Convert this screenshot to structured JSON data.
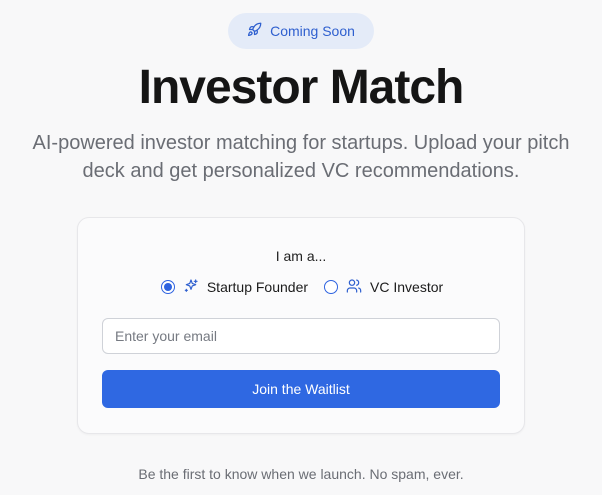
{
  "badge": {
    "label": "Coming Soon",
    "icon": "rocket-icon"
  },
  "hero": {
    "title": "Investor Match",
    "subtitle": "AI-powered investor matching for startups. Upload your pitch deck and get personalized VC recommendations."
  },
  "form": {
    "prompt": "I am a...",
    "roles": [
      {
        "label": "Startup Founder",
        "icon": "sparkles-icon",
        "selected": true
      },
      {
        "label": "VC Investor",
        "icon": "users-icon",
        "selected": false
      }
    ],
    "email_placeholder": "Enter your email",
    "email_value": "",
    "submit_label": "Join the Waitlist"
  },
  "footer": {
    "text": "Be the first to know when we launch. No spam, ever."
  },
  "colors": {
    "accent": "#2f68e2",
    "badge_bg": "#e4ebf8",
    "background": "#f8f8f9"
  }
}
